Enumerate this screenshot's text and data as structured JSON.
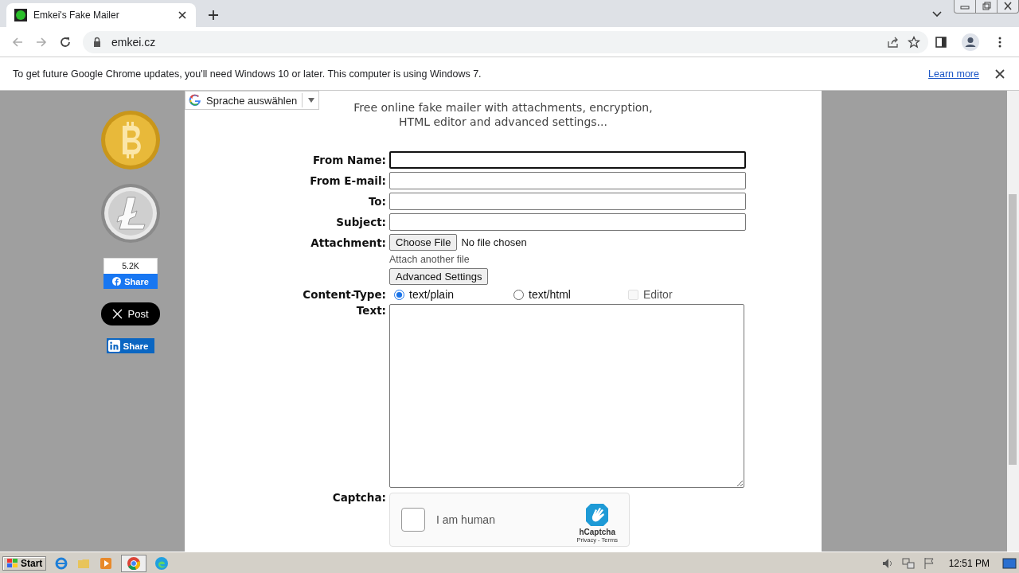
{
  "browser": {
    "tab_title": "Emkei's Fake Mailer",
    "url": "emkei.cz",
    "infobar": {
      "message": "To get future Google Chrome updates, you'll need Windows 10 or later. This computer is using Windows 7.",
      "link": "Learn more"
    }
  },
  "sidebar": {
    "facebook": {
      "count": "5.2K",
      "label": "Share"
    },
    "x_post": {
      "label": "Post"
    },
    "linkedin": {
      "label": "Share"
    }
  },
  "translate": {
    "label": "Sprache auswählen"
  },
  "heading": [
    "Free online fake mailer with attachments, encryption,",
    "HTML editor and advanced settings..."
  ],
  "fields": [
    {
      "label": "From Name:",
      "focused": true
    },
    {
      "label": "From E-mail:",
      "focused": false
    },
    {
      "label": "To:",
      "focused": false
    },
    {
      "label": "Subject:",
      "focused": false
    }
  ],
  "attachment": {
    "label": "Attachment:",
    "button": "Choose File",
    "status": "No file chosen",
    "link": "Attach another file"
  },
  "advanced_button": "Advanced Settings",
  "content_type": {
    "label": "Content-Type:",
    "options": [
      {
        "label": "text/plain",
        "selected": true
      },
      {
        "label": "text/html",
        "selected": false
      }
    ],
    "editor": {
      "label": "Editor",
      "checked": false,
      "disabled": true
    }
  },
  "text": {
    "label": "Text:"
  },
  "captcha": {
    "label": "Captcha:",
    "checkbox": "I am human",
    "checked": false,
    "brand": "hCaptcha",
    "links": "Privacy - Terms"
  },
  "taskbar": {
    "start": "Start",
    "clock": "12:51 PM"
  }
}
